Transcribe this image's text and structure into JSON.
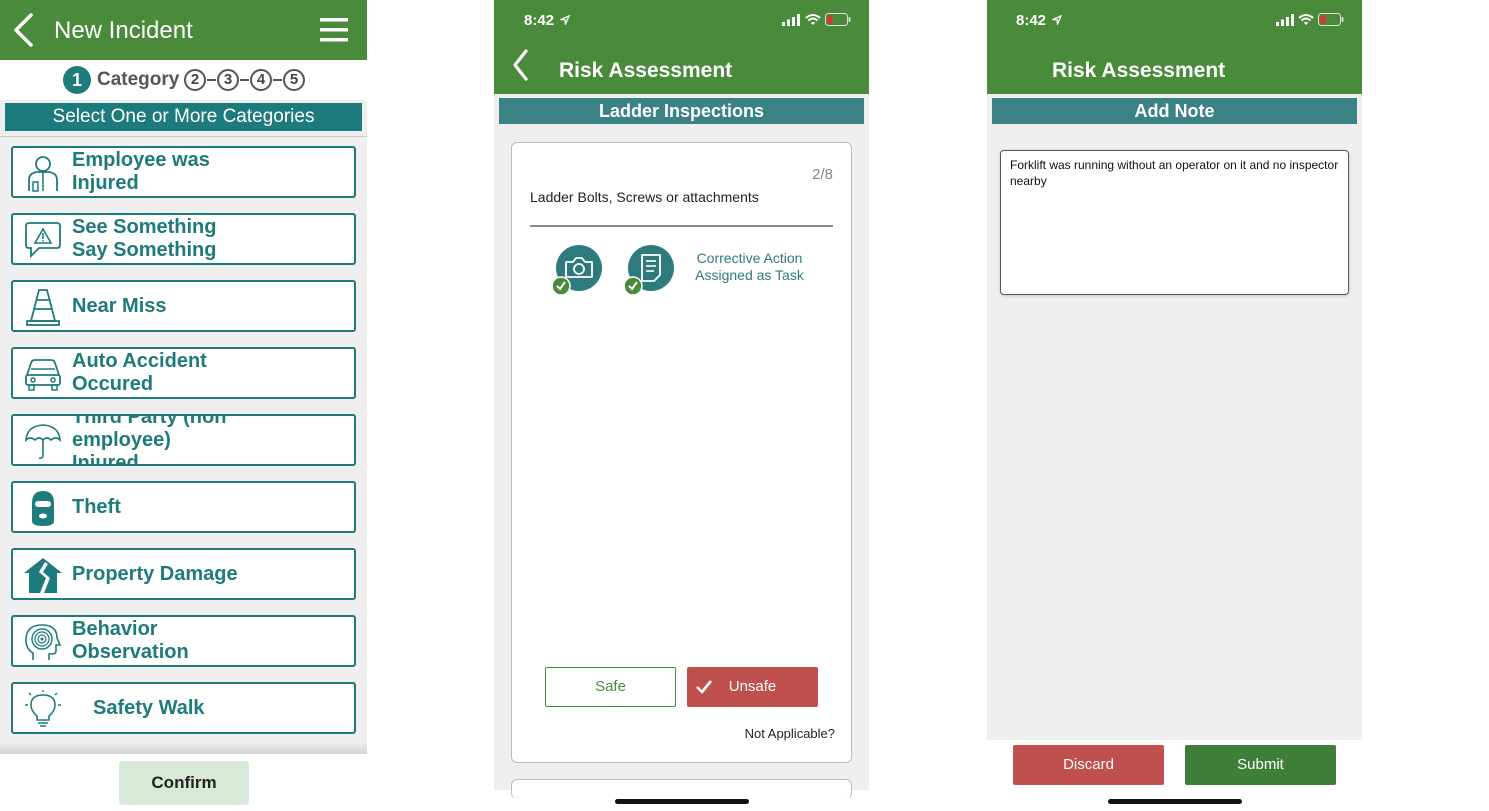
{
  "incident": {
    "title": "New Incident",
    "steps": {
      "active_num": "1",
      "active_label": "Category",
      "others": [
        "2",
        "3",
        "4",
        "5"
      ]
    },
    "banner": "Select One or More Categories",
    "categories": [
      {
        "label": "Employee was\nInjured",
        "icon": "injured-person-icon"
      },
      {
        "label": "See Something\nSay Something",
        "icon": "warning-speech-icon"
      },
      {
        "label": "Near Miss",
        "icon": "traffic-cone-icon"
      },
      {
        "label": "Auto Accident\nOccured",
        "icon": "car-icon"
      },
      {
        "label": "Third Party (non\nemployee)\nInjured",
        "icon": "umbrella-icon"
      },
      {
        "label": "Theft",
        "icon": "balaclava-icon"
      },
      {
        "label": "Property Damage",
        "icon": "damaged-house-icon"
      },
      {
        "label": "Behavior\nObservation",
        "icon": "brain-head-icon"
      },
      {
        "label": "Safety Walk",
        "icon": "lightbulb-icon"
      }
    ],
    "confirm": "Confirm"
  },
  "assessment": {
    "time": "8:42",
    "title": "Risk Assessment",
    "section": "Ladder Inspections",
    "counter": "2/8",
    "question": "Ladder Bolts, Screws or attachments",
    "corrective": "Corrective Action\nAssigned as Task",
    "safe": "Safe",
    "unsafe": "Unsafe",
    "not_applicable": "Not Applicable?"
  },
  "note": {
    "time": "8:42",
    "title": "Risk Assessment",
    "section": "Add Note",
    "text": "Forklift was running without an operator on it and no inspector nearby",
    "discard": "Discard",
    "submit": "Submit"
  },
  "colors": {
    "header_green": "#4a8a3b",
    "teal": "#1e7b7b",
    "banner_teal": "#3b8284",
    "danger": "#c0504d"
  }
}
